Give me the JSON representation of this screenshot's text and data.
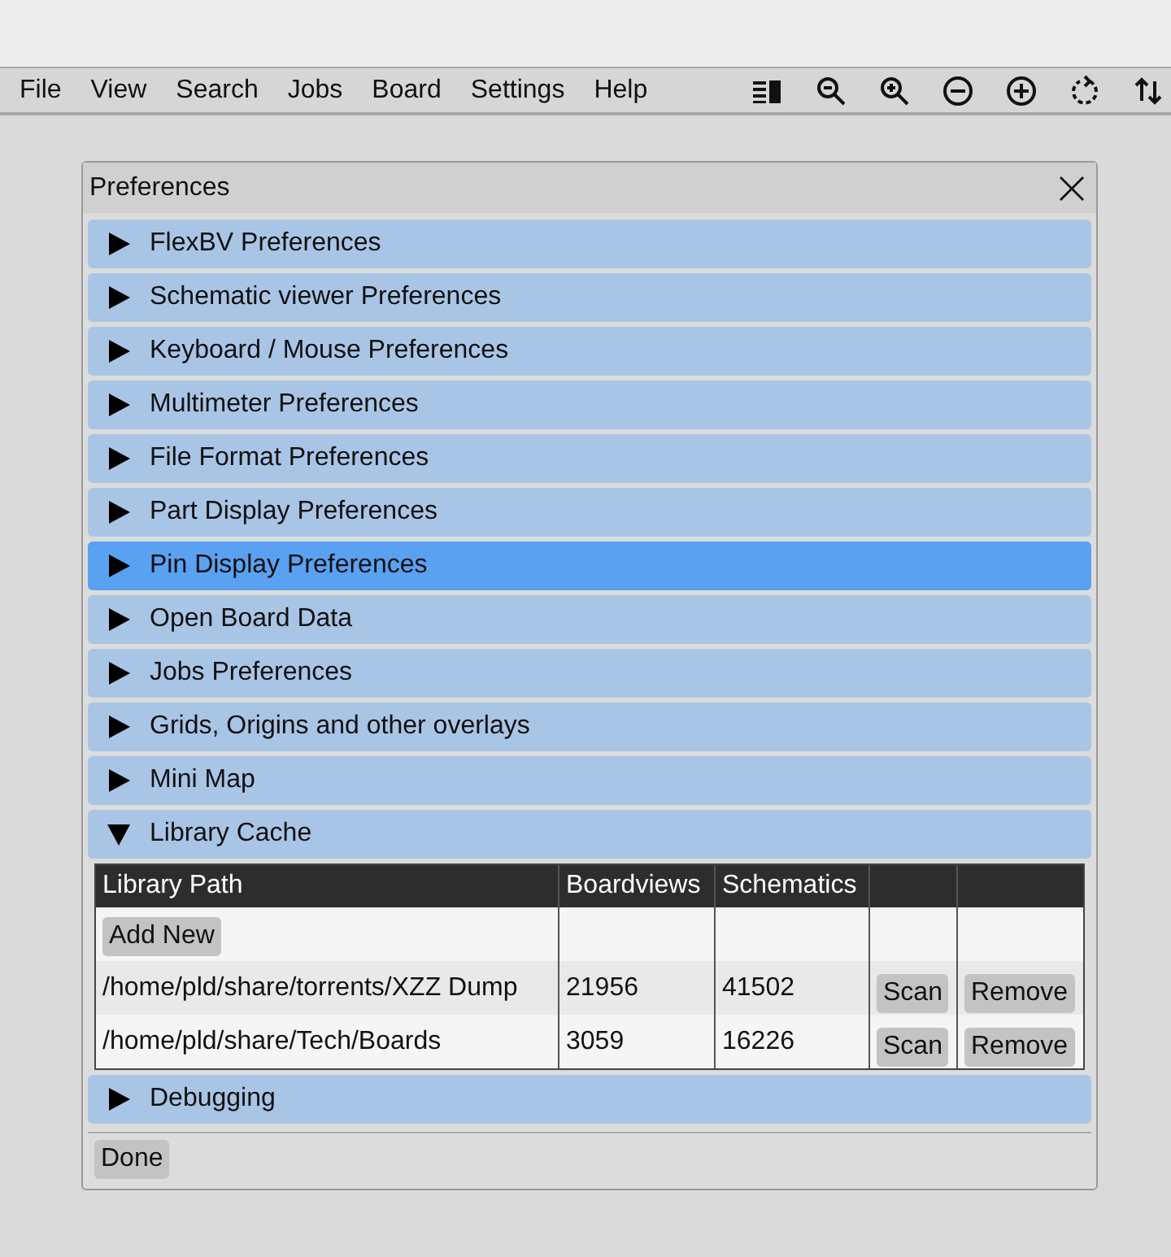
{
  "menu": [
    "File",
    "View",
    "Search",
    "Jobs",
    "Board",
    "Settings",
    "Help"
  ],
  "toolbar": [
    {
      "kind": "panel"
    },
    {
      "kind": "zoom_out"
    },
    {
      "kind": "zoom_in"
    },
    {
      "kind": "minus"
    },
    {
      "kind": "plus"
    },
    {
      "kind": "rotate"
    },
    {
      "kind": "flip"
    }
  ],
  "dialog": {
    "title": "Preferences",
    "sections": [
      {
        "label": "FlexBV Preferences",
        "expanded": false,
        "selected": false
      },
      {
        "label": "Schematic viewer Preferences",
        "expanded": false,
        "selected": false
      },
      {
        "label": "Keyboard / Mouse Preferences",
        "expanded": false,
        "selected": false
      },
      {
        "label": "Multimeter Preferences",
        "expanded": false,
        "selected": false
      },
      {
        "label": "File Format Preferences",
        "expanded": false,
        "selected": false
      },
      {
        "label": "Part Display Preferences",
        "expanded": false,
        "selected": false
      },
      {
        "label": "Pin Display Preferences",
        "expanded": false,
        "selected": true
      },
      {
        "label": "Open Board Data",
        "expanded": false,
        "selected": false
      },
      {
        "label": "Jobs Preferences",
        "expanded": false,
        "selected": false
      },
      {
        "label": "Grids, Origins and other overlays",
        "expanded": false,
        "selected": false
      },
      {
        "label": "Mini Map",
        "expanded": false,
        "selected": false
      },
      {
        "label": "Library Cache",
        "expanded": true,
        "selected": false,
        "table": {
          "columns": [
            "Library Path",
            "Boardviews",
            "Schematics"
          ],
          "add_button": "Add New",
          "rows": [
            {
              "path": "/home/pld/share/torrents/XZZ Dump",
              "boardviews": "21956",
              "schematics": "41502",
              "scan": "Scan",
              "remove": "Remove"
            },
            {
              "path": "/home/pld/share/Tech/Boards",
              "boardviews": "3059",
              "schematics": "16226",
              "scan": "Scan",
              "remove": "Remove"
            }
          ]
        }
      },
      {
        "label": "Debugging",
        "expanded": false,
        "selected": false
      }
    ],
    "done": "Done"
  }
}
